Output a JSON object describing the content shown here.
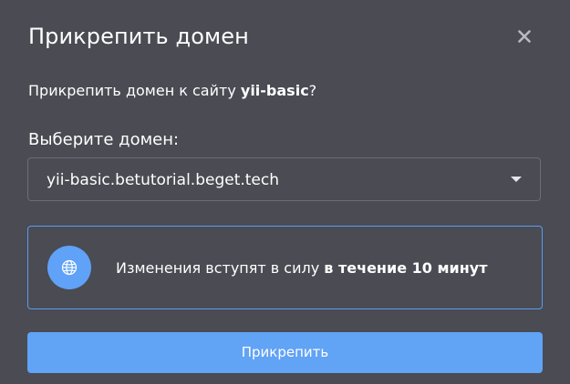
{
  "dialog": {
    "title": "Прикрепить домен",
    "close_icon": "close-icon",
    "question_prefix": "Прикрепить домен к сайту ",
    "site_name": "yii-basic",
    "question_suffix": "?",
    "select_label": "Выберите домен:",
    "selected_domain": "yii-basic.betutorial.beget.tech",
    "caret_icon": "chevron-down-icon",
    "notice": {
      "icon": "globe-icon",
      "text_prefix": "Изменения вступят в силу ",
      "text_bold": "в течение 10 минут"
    },
    "submit_label": "Прикрепить"
  },
  "colors": {
    "background": "#4a4b53",
    "accent": "#61a3f5",
    "notice_border": "#5b9bf2",
    "select_border": "#6c6d76",
    "text": "#ffffff"
  }
}
